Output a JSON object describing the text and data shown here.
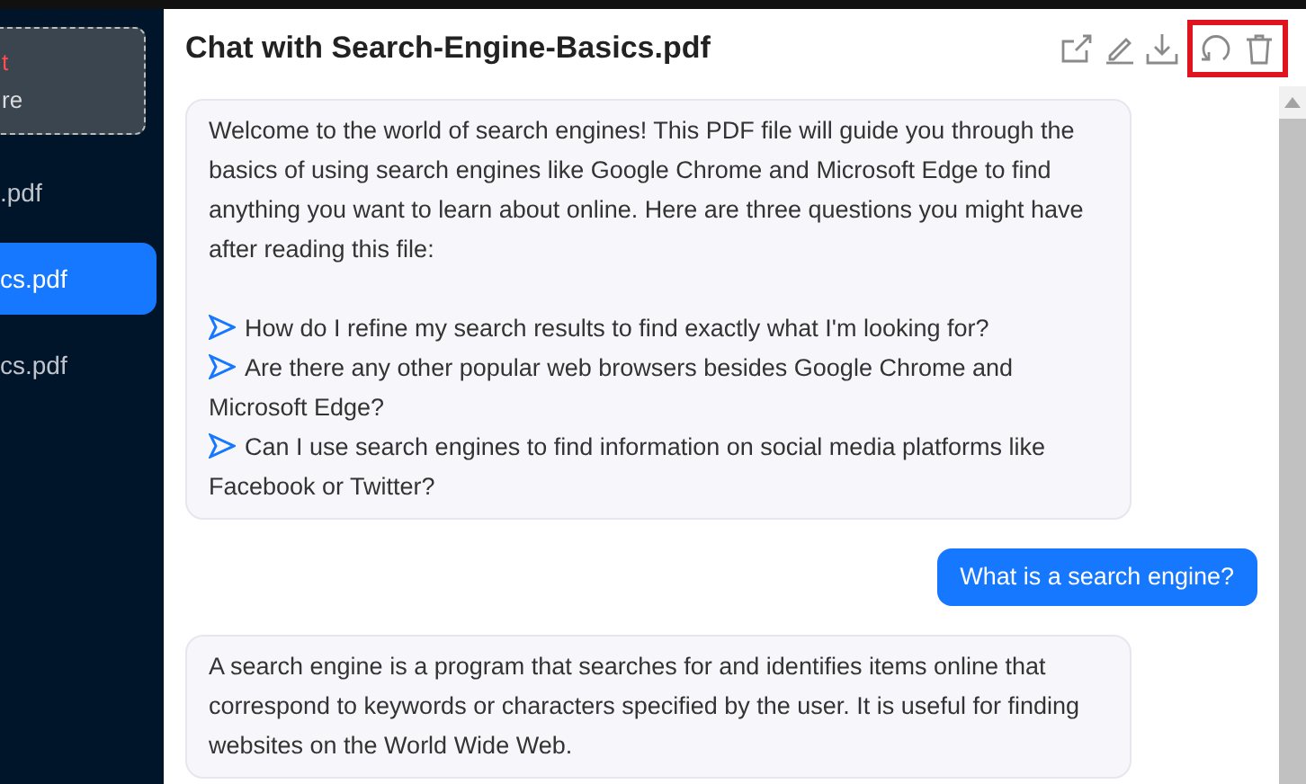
{
  "sidebar": {
    "upload": {
      "line_1": "t",
      "line_2": "re"
    },
    "items": [
      {
        "label": ".pdf",
        "selected": false
      },
      {
        "label": "cs.pdf",
        "selected": true
      },
      {
        "label": "cs.pdf",
        "selected": false
      }
    ]
  },
  "header": {
    "title": "Chat with Search-Engine-Basics.pdf",
    "actions": [
      {
        "kind": "share"
      },
      {
        "kind": "edit"
      },
      {
        "kind": "download"
      }
    ],
    "highlighted_actions": [
      {
        "kind": "refresh"
      },
      {
        "kind": "delete"
      }
    ]
  },
  "messages": [
    {
      "kind": "bot",
      "text": "Welcome to the world of search engines! This PDF file will guide you through the basics of using search engines like Google Chrome and Microsoft Edge to find anything you want to learn about online. Here are three questions you might have after reading this file:",
      "questions": [
        "How do I refine my search results to find exactly what I'm looking for?",
        "Are there any other popular web browsers besides Google Chrome and Microsoft Edge?",
        "Can I use search engines to find information on social media platforms like Facebook or Twitter?"
      ]
    },
    {
      "kind": "user",
      "text": "What is a search engine?"
    },
    {
      "kind": "bot",
      "text": "A search engine is a program that searches for and identifies items online that correspond to keywords or characters specified by the user. It is useful for finding websites on the World Wide Web."
    }
  ]
}
